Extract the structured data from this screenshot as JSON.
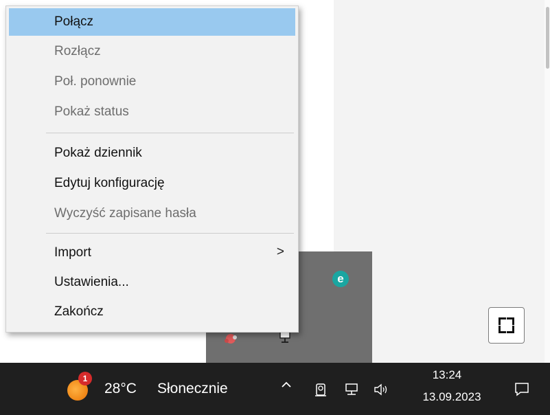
{
  "menu": {
    "items": [
      {
        "label": "Połącz",
        "state": "highlighted"
      },
      {
        "label": "Rozłącz",
        "state": "disabled"
      },
      {
        "label": "Poł. ponownie",
        "state": "disabled"
      },
      {
        "label": "Pokaż status",
        "state": "disabled"
      },
      {
        "label": "Pokaż dziennik",
        "state": "enabled"
      },
      {
        "label": "Edytuj konfigurację",
        "state": "enabled"
      },
      {
        "label": "Wyczyść zapisane hasła",
        "state": "disabled"
      },
      {
        "label": "Import",
        "state": "enabled",
        "submenu_arrow": ">"
      },
      {
        "label": "Ustawienia...",
        "state": "enabled"
      },
      {
        "label": "Zakończ",
        "state": "enabled"
      }
    ]
  },
  "tray_overflow": {
    "icons": [
      "eset-icon",
      "openvpn-tray-icon",
      "monitor-tray-icon"
    ],
    "eset_glyph": "e"
  },
  "taskbar": {
    "weather": {
      "temperature": "28°C",
      "condition": "Słonecznie",
      "badge_count": "1"
    },
    "chevron": "^",
    "clock": {
      "time": "13:24",
      "date": "13.09.2023"
    }
  },
  "colors": {
    "highlight": "#99c9ef",
    "disabled_text": "#6d6d6d",
    "taskbar": "#1f1f1f",
    "eset": "#1aa6a1"
  }
}
